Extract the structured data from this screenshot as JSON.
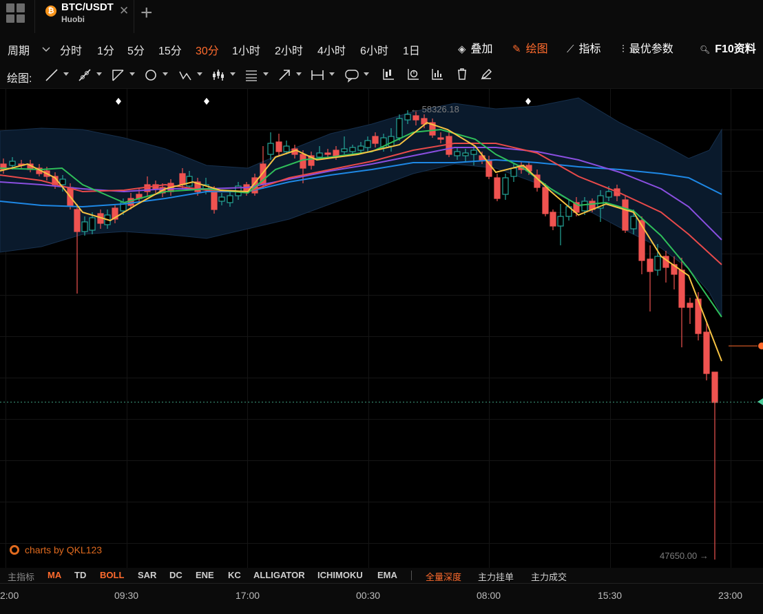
{
  "tab": {
    "symbol": "BTC/USDT",
    "exchange": "Huobi",
    "close": "✕",
    "add": "+"
  },
  "periods": {
    "label": "周期",
    "dropdown_icon": "chevron-down-icon",
    "items": [
      "分时",
      "1分",
      "5分",
      "15分",
      "30分",
      "1小时",
      "2小时",
      "4小时",
      "6小时",
      "1日"
    ],
    "active": "30分"
  },
  "right_menu": {
    "overlay": "叠加",
    "draw": "绘图",
    "indicator": "指标",
    "best_params": "最优参数",
    "f10": "F10资料"
  },
  "drawing": {
    "label": "绘图:"
  },
  "chart": {
    "high_label": "← 58326.18",
    "low_label": "47650.00 →",
    "watermark": "charts by QKL123",
    "colors": {
      "up": "#26a69a",
      "down": "#ef5350",
      "ma5": "#f6c343",
      "ma10": "#2fbf5a",
      "ma20": "#e84a4a",
      "ma30": "#8a4fe0",
      "ma60": "#1e88e5",
      "band_fill": "#0a1a2c",
      "band_line": "#17304d",
      "accent": "#ff6b2d"
    }
  },
  "indicators": {
    "label": "主指标",
    "items": [
      "MA",
      "TD",
      "BOLL",
      "SAR",
      "DC",
      "ENE",
      "KC",
      "ALLIGATOR",
      "ICHIMOKU",
      "EMA"
    ],
    "active": [
      "MA",
      "BOLL"
    ],
    "depth": "全量深度",
    "orders": "主力挂单",
    "trades": "主力成交"
  },
  "time_axis": [
    "2:00",
    "09:30",
    "17:00",
    "00:30",
    "08:00",
    "15:30",
    "23:00"
  ]
}
